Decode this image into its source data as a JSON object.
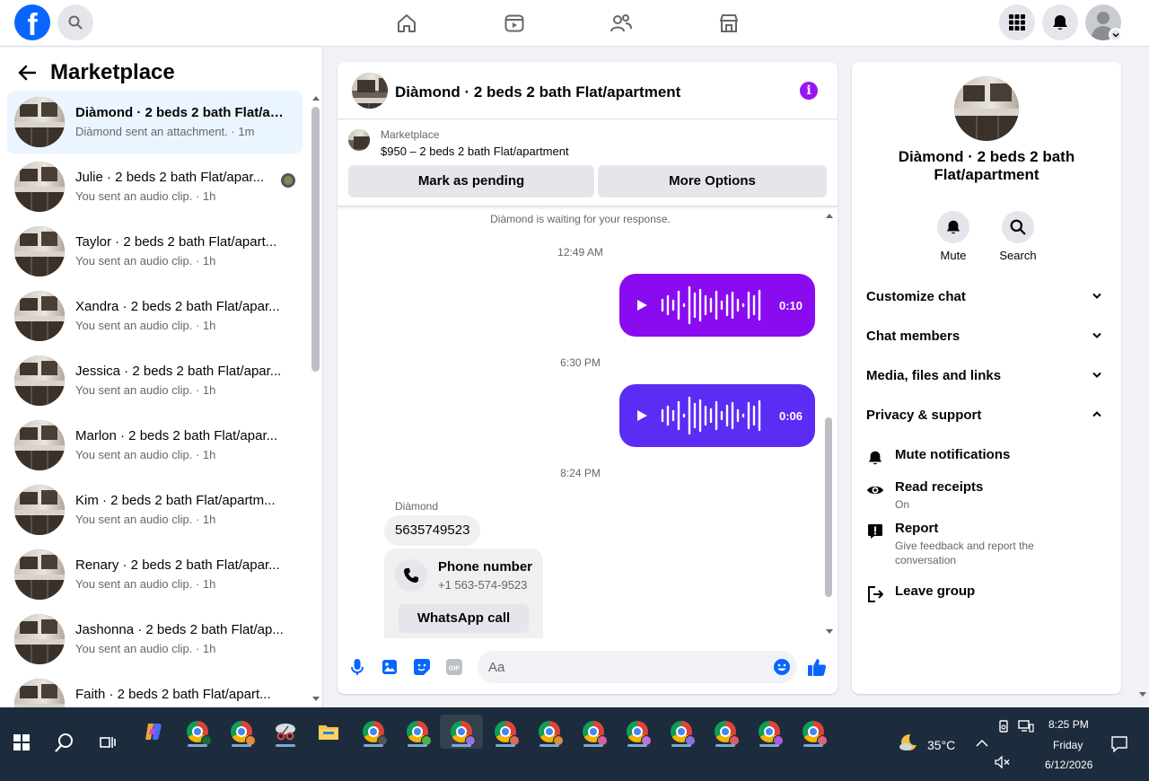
{
  "topbar": {
    "logo_letter": "f",
    "icons": [
      "search-icon",
      "home-icon",
      "video-icon",
      "friends-icon",
      "marketplace-icon",
      "menu-grid-icon",
      "notifications-icon",
      "account-avatar"
    ]
  },
  "left": {
    "title": "Marketplace",
    "conversations": [
      {
        "name": "Diàmond · 2 beds 2 bath Flat/ap...",
        "sub": "Diàmond sent an attachment. · 1m"
      },
      {
        "name": "Julie · 2 beds 2 bath Flat/apar...",
        "sub": "You sent an audio clip. · 1h"
      },
      {
        "name": "Taylor · 2 beds 2 bath Flat/apart...",
        "sub": "You sent an audio clip. · 1h"
      },
      {
        "name": "Xandra · 2 beds 2 bath Flat/apar...",
        "sub": "You sent an audio clip. · 1h"
      },
      {
        "name": "Jessica · 2 beds 2 bath Flat/apar...",
        "sub": "You sent an audio clip. · 1h"
      },
      {
        "name": "Marlon · 2 beds 2 bath Flat/apar...",
        "sub": "You sent an audio clip. · 1h"
      },
      {
        "name": "Kim · 2 beds 2 bath Flat/apartm...",
        "sub": "You sent an audio clip. · 1h"
      },
      {
        "name": "Renary · 2 beds 2 bath Flat/apar...",
        "sub": "You sent an audio clip. · 1h"
      },
      {
        "name": "Jashonna · 2 beds 2 bath Flat/ap...",
        "sub": "You sent an audio clip. · 1h"
      },
      {
        "name": "Faith · 2 beds 2 bath Flat/apart...",
        "sub": ""
      }
    ]
  },
  "chat": {
    "title": "Diàmond · 2 beds 2 bath Flat/apartment",
    "marketplace_label": "Marketplace",
    "listing": "$950 – 2 beds 2 bath Flat/apartment",
    "mark_pending": "Mark as pending",
    "more_options": "More Options",
    "waiting_note": "Diàmond is waiting for your response.",
    "time1": "12:49 AM",
    "audio1_duration": "0:10",
    "time2": "6:30 PM",
    "audio2_duration": "0:06",
    "time3": "8:24 PM",
    "sender": "Diàmond",
    "phone_message": "5635749523",
    "phone_card_title": "Phone number",
    "phone_card_number": "+1 563-574-9523",
    "whatsapp_label": "WhatsApp call",
    "composer_placeholder": "Aa"
  },
  "right": {
    "name": "Diàmond · 2 beds 2 bath Flat/apartment",
    "mute_label": "Mute",
    "search_label": "Search",
    "sections": {
      "customize": "Customize chat",
      "members": "Chat members",
      "media": "Media, files and links",
      "privacy": "Privacy & support"
    },
    "options": {
      "mute_notifications": "Mute notifications",
      "read_receipts": "Read receipts",
      "read_receipts_state": "On",
      "report": "Report",
      "report_sub": "Give feedback and report the conversation",
      "leave": "Leave group"
    }
  },
  "taskbar": {
    "weather_temp": "35°C",
    "time": "8:25 PM",
    "day": "Friday",
    "date": "6/12/2026"
  },
  "colors": {
    "accent_blue": "#0866ff",
    "audio_purple": "#8a0bf0",
    "audio_indigo": "#5b2cf3",
    "info_purple": "#9617f3"
  }
}
